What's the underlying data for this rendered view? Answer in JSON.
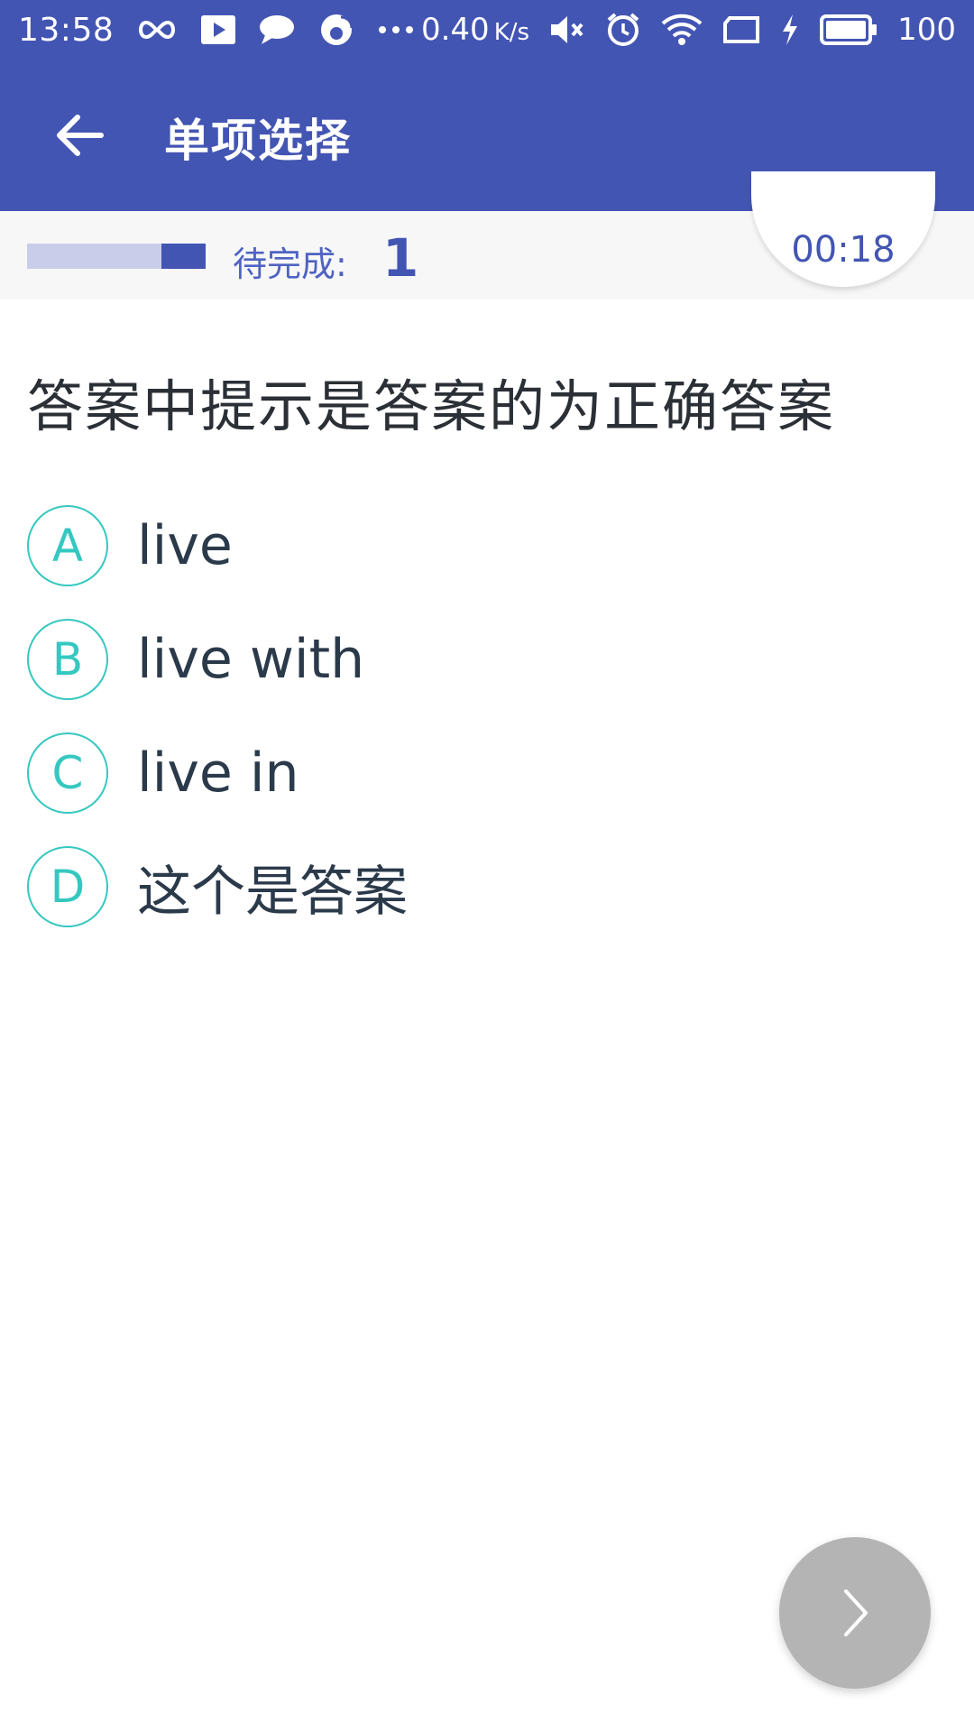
{
  "status_bar": {
    "time": "13:58",
    "net_speed": "0.40",
    "net_unit": "K/s",
    "battery": "100",
    "left_icons": [
      "infinity-icon",
      "play-icon",
      "chat-icon",
      "weibo-icon",
      "more-dots-icon"
    ],
    "right_icons": [
      "mute-icon",
      "alarm-icon",
      "wifi-icon",
      "screen-icon",
      "charging-icon",
      "battery-icon"
    ]
  },
  "app_bar": {
    "title": "单项选择",
    "back_icon": "arrow-left-icon"
  },
  "progress": {
    "pending_label": "待完成:",
    "pending_count": "1",
    "completed_fraction": 0.25,
    "timer": "00:18"
  },
  "question": {
    "text": "答案中提示是答案的为正确答案",
    "options": [
      {
        "letter": "A",
        "text": "live"
      },
      {
        "letter": "B",
        "text": "live with"
      },
      {
        "letter": "C",
        "text": "live in"
      },
      {
        "letter": "D",
        "text": "这个是答案"
      }
    ]
  },
  "next_button": {
    "icon": "chevron-right-icon"
  },
  "colors": {
    "primary": "#4355b3",
    "progress_track": "#c9cdea",
    "option_accent": "#35c8c0",
    "next_button": "#b4b4b4"
  }
}
